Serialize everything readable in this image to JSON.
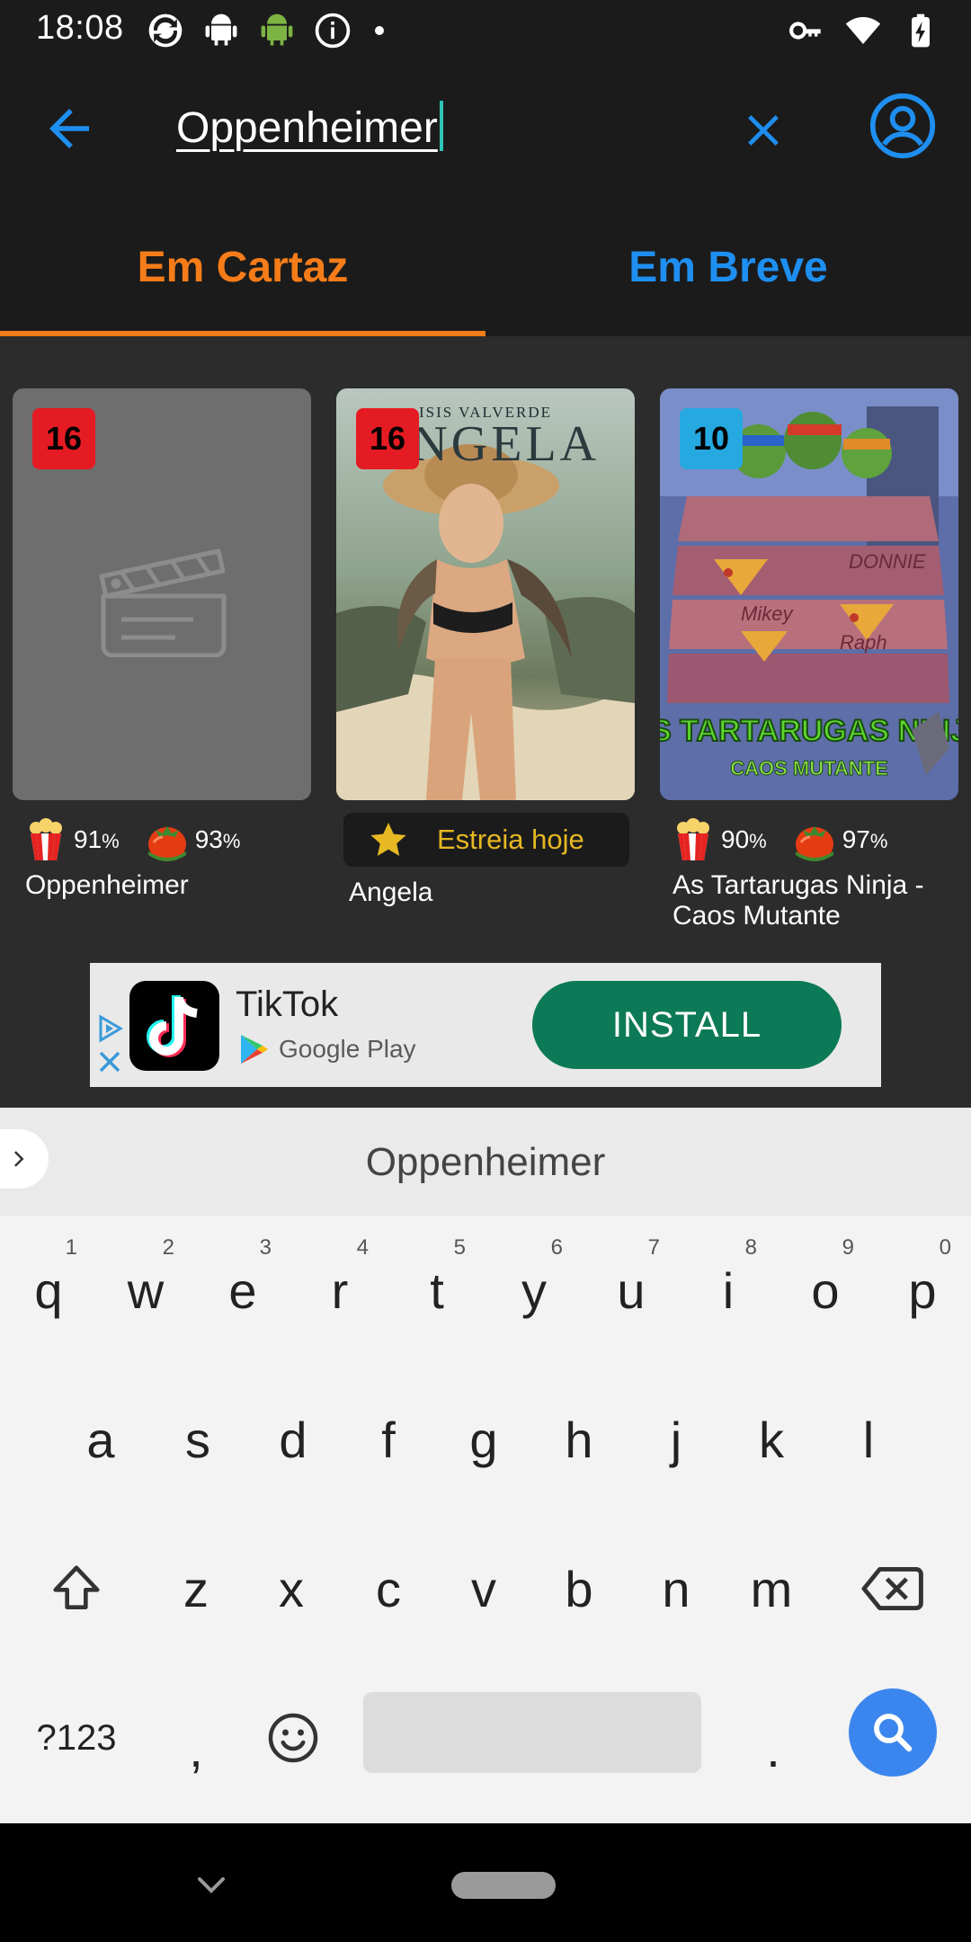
{
  "status_bar": {
    "time": "18:08",
    "left_icons": [
      "sync-icon",
      "android-icon",
      "android-green-icon",
      "info-icon",
      "dot-icon"
    ],
    "right_icons": [
      "key-icon",
      "wifi-icon",
      "battery-charging-icon"
    ]
  },
  "app_bar": {
    "back_icon": "arrow-back-icon",
    "search_value": "Oppenheimer",
    "clear_icon": "close-icon",
    "account_icon": "account-icon"
  },
  "tabs": [
    {
      "label": "Em Cartaz",
      "selected": true
    },
    {
      "label": "Em Breve",
      "selected": false
    }
  ],
  "colors": {
    "accent_orange": "#f57c19",
    "accent_blue": "#1e8ff0",
    "premiere_gold": "#e6b822",
    "install_green": "#0d7a57"
  },
  "movies": [
    {
      "title": "Oppenheimer",
      "age_rating": "16",
      "poster": "placeholder-clapperboard",
      "audience_score": "91",
      "critic_score": "93",
      "pct": "%"
    },
    {
      "title": "Angela",
      "age_rating": "16",
      "poster_text_top": "ISIS VALVERDE",
      "poster_text_title": "ANGELA",
      "premiere_label": "Estreia hoje"
    },
    {
      "title": "As Tartarugas Ninja - Caos Mutante",
      "age_rating": "10",
      "poster_text_title": "AS TARTARUGAS NINJA",
      "poster_text_sub": "CAOS MUTANTE",
      "audience_score": "90",
      "critic_score": "97",
      "pct": "%"
    }
  ],
  "ad": {
    "app_name": "TikTok",
    "store_label": "Google Play",
    "install_label": "INSTALL"
  },
  "keyboard": {
    "suggestion": "Oppenheimer",
    "row1": [
      {
        "key": "q",
        "hint": "1"
      },
      {
        "key": "w",
        "hint": "2"
      },
      {
        "key": "e",
        "hint": "3"
      },
      {
        "key": "r",
        "hint": "4"
      },
      {
        "key": "t",
        "hint": "5"
      },
      {
        "key": "y",
        "hint": "6"
      },
      {
        "key": "u",
        "hint": "7"
      },
      {
        "key": "i",
        "hint": "8"
      },
      {
        "key": "o",
        "hint": "9"
      },
      {
        "key": "p",
        "hint": "0"
      }
    ],
    "row2": [
      "a",
      "s",
      "d",
      "f",
      "g",
      "h",
      "j",
      "k",
      "l"
    ],
    "row3": [
      "z",
      "x",
      "c",
      "v",
      "b",
      "n",
      "m"
    ],
    "symbols_label": "?123",
    "comma": ",",
    "period": "."
  }
}
